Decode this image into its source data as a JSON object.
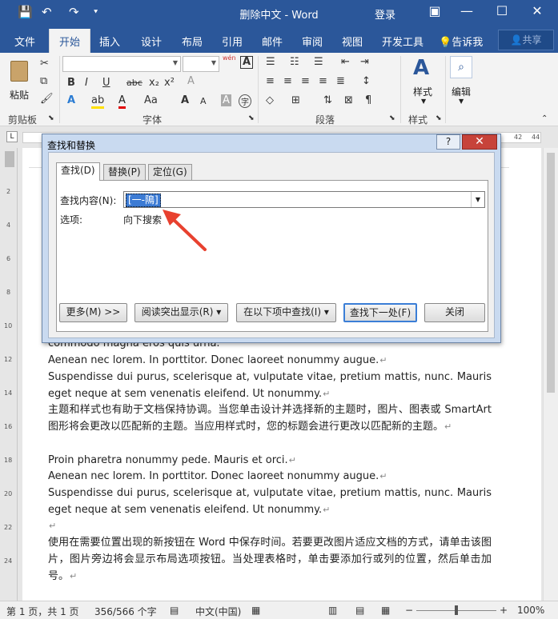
{
  "window": {
    "title": "删除中文 - Word",
    "login": "登录",
    "minimize": "—",
    "restore": "☐",
    "close": "✕"
  },
  "quick_access": {
    "save": "💾",
    "undo": "↶",
    "redo": "↷",
    "customize": "⯆"
  },
  "ribbon_tabs": [
    "文件",
    "开始",
    "插入",
    "设计",
    "布局",
    "引用",
    "邮件",
    "审阅",
    "视图",
    "开发工具"
  ],
  "active_tab": "开始",
  "tell_me": "告诉我",
  "share": "共享",
  "ribbon": {
    "paste": "粘贴",
    "group_clipboard": "剪贴板",
    "group_font": "字体",
    "group_paragraph": "段落",
    "group_styles": "样式",
    "styles_button": "样式",
    "edit_button": "编辑",
    "wen_label": "wén",
    "bold": "B",
    "italic": "I",
    "underline": "U",
    "strikethrough": "abc",
    "subscript": "x₂",
    "superscript": "x²",
    "grow_font": "A",
    "shrink_font": "A",
    "char_border": "A",
    "char_shading": "A",
    "phonetic": "字"
  },
  "ruler": {
    "left_marker": "L",
    "right_numbers": [
      "42",
      "44"
    ]
  },
  "vertical_ruler_numbers": [
    "2",
    "4",
    "6",
    "8",
    "10",
    "12",
    "14",
    "16",
    "18",
    "20",
    "22",
    "24"
  ],
  "dialog": {
    "title": "查找和替换",
    "help": "?",
    "close": "✕",
    "tabs": [
      "查找(D)",
      "替换(P)",
      "定位(G)"
    ],
    "find_label": "查找内容(N):",
    "find_value": "[一-隝]",
    "options_label": "选项:",
    "options_value": "向下搜索",
    "buttons": {
      "more": "更多(M) >>",
      "reading_highlight": "阅读突出显示(R) ▾",
      "find_in": "在以下项中查找(I) ▾",
      "find_next": "查找下一处(F)",
      "close": "关闭"
    }
  },
  "document": {
    "paragraphs": [
      "commodo magna eros quis urna.",
      "Aenean nec lorem. In porttitor. Donec laoreet nonummy augue.",
      "Suspendisse dui purus, scelerisque at, vulputate vitae, pretium mattis, nunc. Mauris eget neque at sem venenatis eleifend. Ut nonummy.",
      "主题和样式也有助于文档保持协调。当您单击设计并选择新的主题时，图片、图表或 SmartArt 图形将会更改以匹配新的主题。当应用样式时，您的标题会进行更改以匹配新的主题。",
      "Proin pharetra nonummy pede. Mauris et orci.",
      "Aenean nec lorem. In porttitor. Donec laoreet nonummy augue.",
      "Suspendisse dui purus, scelerisque at, vulputate vitae, pretium mattis, nunc. Mauris eget neque at sem venenatis eleifend. Ut nonummy.",
      "",
      "使用在需要位置出现的新按钮在 Word 中保存时间。若要更改图片适应文档的方式，请单击该图片，图片旁边将会显示布局选项按钮。当处理表格时，单击要添加行或列的位置，然后单击加号。"
    ],
    "paragraph_mark": "↵"
  },
  "status": {
    "page": "第 1 页，共 1 页",
    "words": "356/566 个字",
    "language": "中文(中国)",
    "zoom": "100%",
    "zoom_minus": "−",
    "zoom_plus": "+"
  },
  "colors": {
    "title_bar": "#2b579a",
    "highlight": "#3c7bd4",
    "arrow": "#e8412f"
  }
}
